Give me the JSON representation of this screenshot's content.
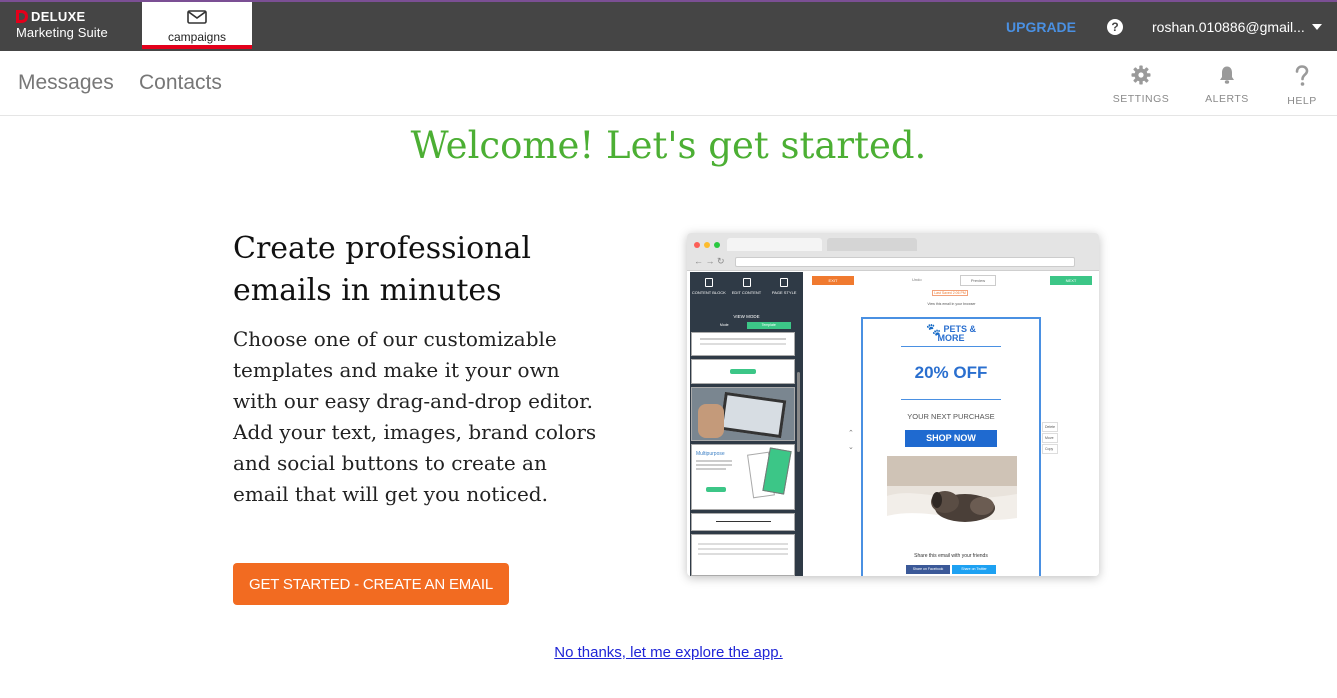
{
  "topbar": {
    "brand_top": "DELUXE",
    "brand_bottom": "Marketing Suite",
    "tab_label": "campaigns",
    "upgrade": "UPGRADE",
    "help_glyph": "?",
    "user": "roshan.010886@gmail...",
    "colors": {
      "bar": "#454545",
      "upgrade": "#4a90e2",
      "tab_underline": "#e3001b"
    }
  },
  "subnav": {
    "messages": "Messages",
    "contacts": "Contacts",
    "settings": "SETTINGS",
    "alerts": "ALERTS",
    "help": "HELP"
  },
  "main": {
    "welcome": "Welcome! Let's get started.",
    "headline": "Create professional emails in minutes",
    "body": "Choose one of our customizable templates and make it your own with our easy drag-and-drop editor. Add your text, images, brand colors and social buttons to create an email that will get you noticed.",
    "cta": "GET STARTED - CREATE AN EMAIL",
    "skip": "No thanks, let me explore the app.",
    "colors": {
      "welcome": "#4caf34",
      "cta": "#f26b21",
      "link": "#1f25d6"
    }
  },
  "preview": {
    "exit": "EXIT",
    "next": "NEXT",
    "preview": "Preview",
    "undo": "Undo",
    "saved": "Last Saved 2:06 PM",
    "view_browser": "View this email in your browser",
    "tools": [
      "CONTENT BLOCK",
      "EDIT CONTENT",
      "PAGE STYLE"
    ],
    "view_mode": "VIEW MODE",
    "view_options": [
      "Mode",
      "Template"
    ],
    "multipurpose": "Multipurpose",
    "logo_line1": "PETS &",
    "logo_line2": "MORE",
    "offer": "20% OFF",
    "next_purchase": "YOUR NEXT PURCHASE",
    "shop_now": "SHOP NOW",
    "share": "Share this email with your friends",
    "facebook": "Share on Facebook",
    "twitter": "Share on Twitter",
    "side_tools": [
      "Delete",
      "Move",
      "Copy"
    ]
  }
}
